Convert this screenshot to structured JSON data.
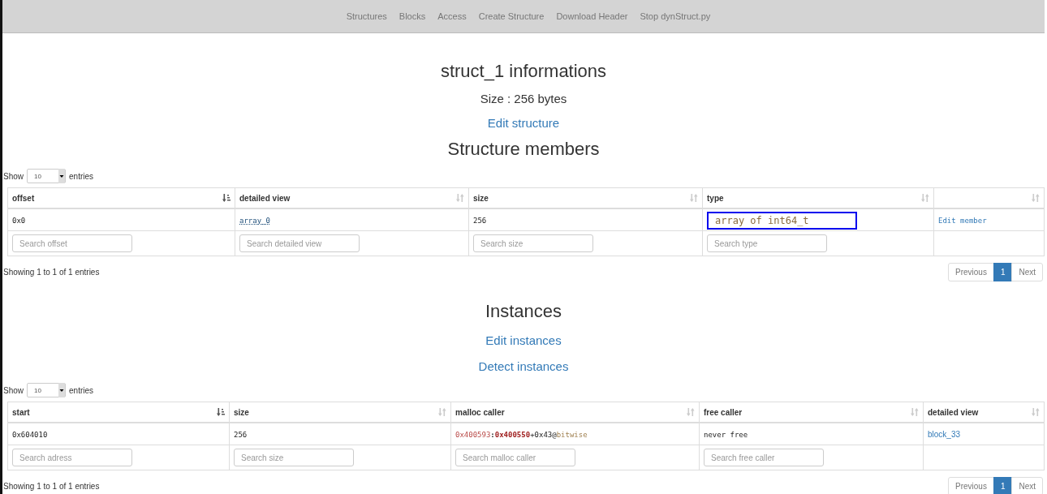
{
  "nav": [
    {
      "label": "Structures"
    },
    {
      "label": "Blocks"
    },
    {
      "label": "Access"
    },
    {
      "label": "Create Structure"
    },
    {
      "label": "Download Header"
    },
    {
      "label": "Stop dynStruct.py"
    }
  ],
  "title": "struct_1 informations",
  "size_text": "Size : 256 bytes",
  "edit_structure": "Edit structure",
  "members": {
    "heading": "Structure members",
    "length": {
      "before": "Show",
      "value": "10",
      "after": "entries"
    },
    "columns": [
      {
        "label": "offset",
        "sorted": true
      },
      {
        "label": "detailed view",
        "sorted": false
      },
      {
        "label": "size",
        "sorted": false
      },
      {
        "label": "type",
        "sorted": false
      },
      {
        "sorted": false
      }
    ],
    "rows": [
      [
        {
          "kind": "code",
          "text": "0x0"
        },
        {
          "kind": "code-link",
          "text": "array_0"
        },
        {
          "kind": "code",
          "text": "256"
        },
        {
          "kind": "type-box",
          "text": "array of int64_t"
        },
        {
          "kind": "code-action",
          "text": "Edit member"
        }
      ]
    ],
    "searches": [
      {
        "placeholder": "Search offset"
      },
      {
        "placeholder": "Search detailed view"
      },
      {
        "placeholder": "Search size"
      },
      {
        "placeholder": "Search type"
      }
    ],
    "info": "Showing 1 to 1 of 1 entries",
    "pages": [
      {
        "label": "Previous",
        "selected": false
      },
      {
        "label": "1",
        "selected": true
      },
      {
        "label": "Next",
        "selected": false
      }
    ]
  },
  "instances_heading": "Instances",
  "edit_instances": "Edit instances",
  "detect_instances": "Detect instances",
  "instances": {
    "length": {
      "before": "Show",
      "value": "10",
      "after": "entries"
    },
    "columns": [
      {
        "label": "start",
        "sorted": true
      },
      {
        "label": "size",
        "sorted": false
      },
      {
        "label": "malloc caller",
        "sorted": false
      },
      {
        "label": "free caller",
        "sorted": false
      },
      {
        "label": "detailed view",
        "sorted": false
      }
    ],
    "rows": [
      [
        {
          "kind": "code",
          "text": "0x604010"
        },
        {
          "kind": "code",
          "text": "256"
        },
        {
          "kind": "caller",
          "parts": [
            {
              "kind": "addr",
              "text": "0x400593"
            },
            {
              "kind": "sep",
              "text": ":"
            },
            {
              "kind": "target",
              "text": "0x400550"
            },
            {
              "kind": "plain",
              "text": "+0x43@"
            },
            {
              "kind": "module",
              "text": "bitwise"
            }
          ]
        },
        {
          "kind": "code",
          "text": "never free"
        },
        {
          "kind": "link",
          "text": "block_33"
        }
      ]
    ],
    "searches": [
      {
        "placeholder": "Search adress"
      },
      {
        "placeholder": "Search size"
      },
      {
        "placeholder": "Search malloc caller"
      },
      {
        "placeholder": "Search free caller"
      }
    ],
    "info": "Showing 1 to 1 of 1 entries",
    "pages": [
      {
        "label": "Previous",
        "selected": false
      },
      {
        "label": "1",
        "selected": true
      },
      {
        "label": "Next",
        "selected": false
      }
    ]
  }
}
